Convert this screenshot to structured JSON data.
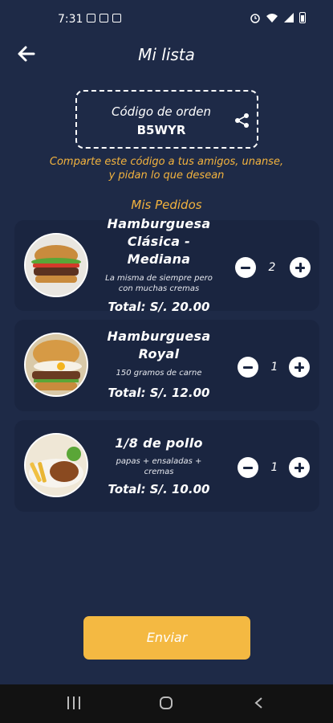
{
  "status_bar": {
    "time": "7:31"
  },
  "header": {
    "title": "Mi lista"
  },
  "code_box": {
    "label": "Código de orden",
    "code": "B5WYR"
  },
  "share_message": "Comparte este código a tus amigos, unanse, y pidan lo que desean",
  "section_title": "Mis Pedidos",
  "orders": [
    {
      "name": "Hamburguesa Clásica - Mediana",
      "description": "La misma de siempre pero con muchas cremas",
      "total": "Total: S/. 20.00",
      "quantity": "2"
    },
    {
      "name": "Hamburguesa Royal",
      "description": "150 gramos de carne",
      "total": "Total: S/. 12.00",
      "quantity": "1"
    },
    {
      "name": "1/8 de pollo",
      "description": "papas + ensaladas + cremas",
      "total": "Total: S/. 10.00",
      "quantity": "1"
    }
  ],
  "send_button": {
    "label": "Enviar"
  },
  "colors": {
    "background": "#1e2a47",
    "card": "#1a2540",
    "accent": "#f4b942",
    "accent_text": "#f3b33e"
  },
  "icons": [
    "arrow-left-icon",
    "share-icon",
    "minus-icon",
    "plus-icon"
  ]
}
